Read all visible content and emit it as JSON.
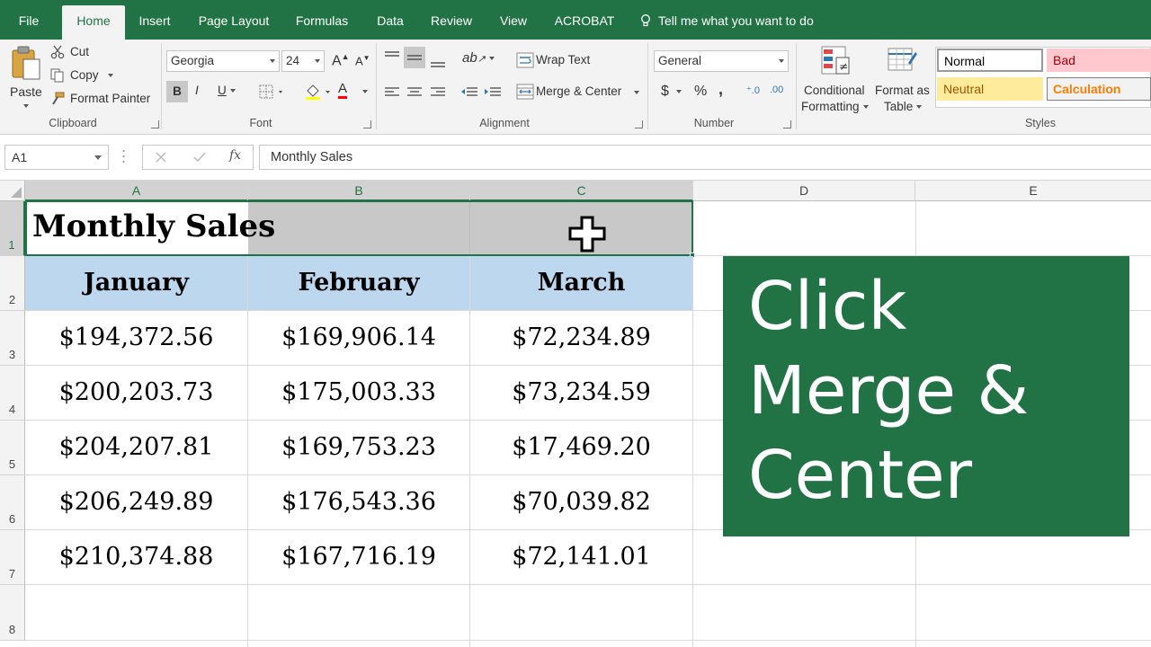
{
  "menu": {
    "tabs": [
      "File",
      "Home",
      "Insert",
      "Page Layout",
      "Formulas",
      "Data",
      "Review",
      "View",
      "ACROBAT"
    ],
    "active_tab": "Home",
    "tell_me": "Tell me what you want to do"
  },
  "ribbon": {
    "clipboard": {
      "paste": "Paste",
      "cut": "Cut",
      "copy": "Copy",
      "format_painter": "Format Painter",
      "label": "Clipboard"
    },
    "font": {
      "family": "Georgia",
      "size": "24",
      "grow": "A",
      "shrink": "A",
      "bold": "B",
      "italic": "I",
      "underline": "U",
      "fill_color": "A",
      "font_color": "A",
      "label": "Font"
    },
    "alignment": {
      "wrap_text": "Wrap Text",
      "merge_center": "Merge & Center",
      "label": "Alignment"
    },
    "number": {
      "format": "General",
      "currency": "$",
      "percent": "%",
      "comma": ",",
      "label": "Number"
    },
    "conditional_formatting": [
      "Conditional",
      "Formatting"
    ],
    "format_as_table": [
      "Format as",
      "Table"
    ],
    "styles": {
      "normal": "Normal",
      "bad": "Bad",
      "neutral": "Neutral",
      "calculation": "Calculation",
      "label": "Styles"
    }
  },
  "formula_bar": {
    "name_box": "A1",
    "fx": "fx",
    "content": "Monthly Sales"
  },
  "sheet": {
    "columns": [
      "A",
      "B",
      "C",
      "D",
      "E"
    ],
    "rows": [
      "1",
      "2",
      "3",
      "4",
      "5",
      "6",
      "7",
      "8"
    ],
    "title": "Monthly Sales",
    "headers": [
      "January",
      "February",
      "March"
    ],
    "data": [
      [
        "$194,372.56",
        "$169,906.14",
        "$72,234.89"
      ],
      [
        "$200,203.73",
        "$175,003.33",
        "$73,234.59"
      ],
      [
        "$204,207.81",
        "$169,753.23",
        "$17,469.20"
      ],
      [
        "$206,249.89",
        "$176,543.36",
        "$70,039.82"
      ],
      [
        "$210,374.88",
        "$167,716.19",
        "$72,141.01"
      ]
    ]
  },
  "callout": {
    "lines": [
      "Click",
      "Merge &",
      "Center"
    ]
  },
  "colors": {
    "excel_green": "#217346",
    "header_fill": "#bdd7ee",
    "bad_fill": "#ffc7ce",
    "neutral_fill": "#ffeb9c"
  }
}
